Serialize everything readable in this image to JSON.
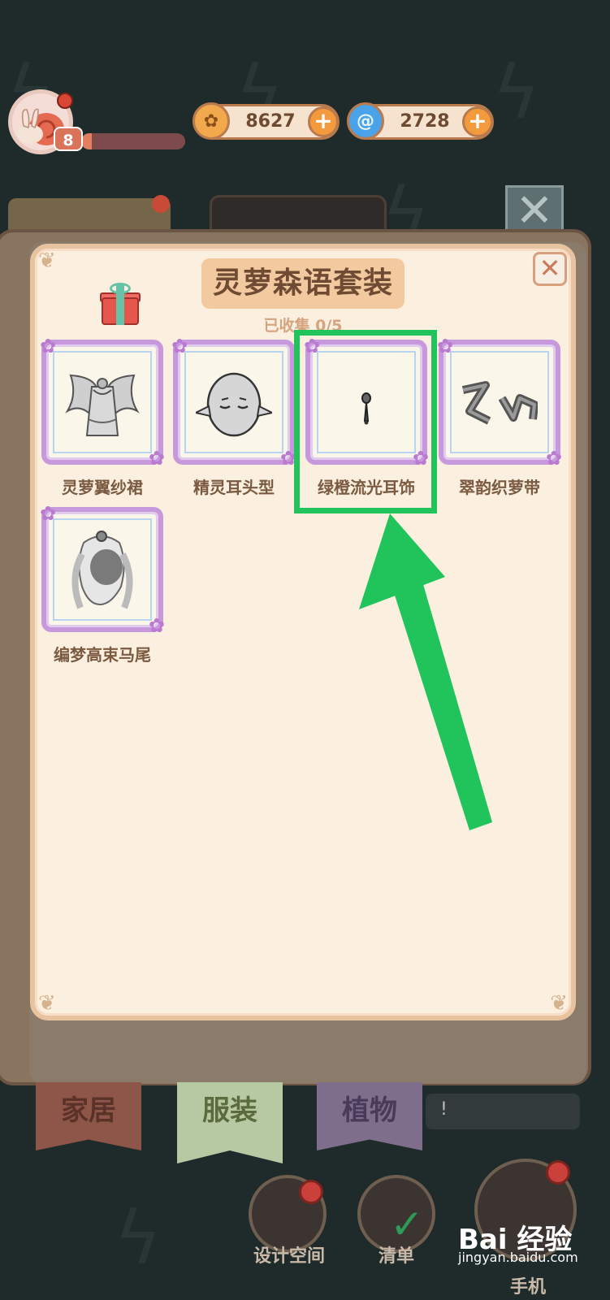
{
  "hud": {
    "level": "8",
    "xp_fraction": 0.1,
    "coins": "8627",
    "gems": "2728"
  },
  "panel": {
    "title": "灵萝森语套装",
    "collected": "已收集 0/5"
  },
  "items": [
    {
      "label": "灵萝翼纱裙",
      "icon": "winged-dress-icon"
    },
    {
      "label": "精灵耳头型",
      "icon": "elf-ear-head-icon"
    },
    {
      "label": "绿橙流光耳饰",
      "icon": "earring-icon"
    },
    {
      "label": "翠韵织萝带",
      "icon": "ribbon-icon"
    },
    {
      "label": "编梦高束马尾",
      "icon": "ponytail-icon"
    }
  ],
  "bottom_tabs": {
    "home": "家居",
    "clothing": "服装",
    "plants": "植物",
    "chat_mark": "!"
  },
  "bottom_buttons": {
    "design": "设计空间",
    "list": "清单",
    "phone": "手机"
  },
  "watermark": {
    "main": "Bai 经验",
    "url": "jingyan.baidu.com"
  },
  "colors": {
    "highlight": "#21c45b",
    "panel_bg": "#fbefe0",
    "title_banner": "#f3c9a0",
    "card_border": "#c898dd"
  }
}
